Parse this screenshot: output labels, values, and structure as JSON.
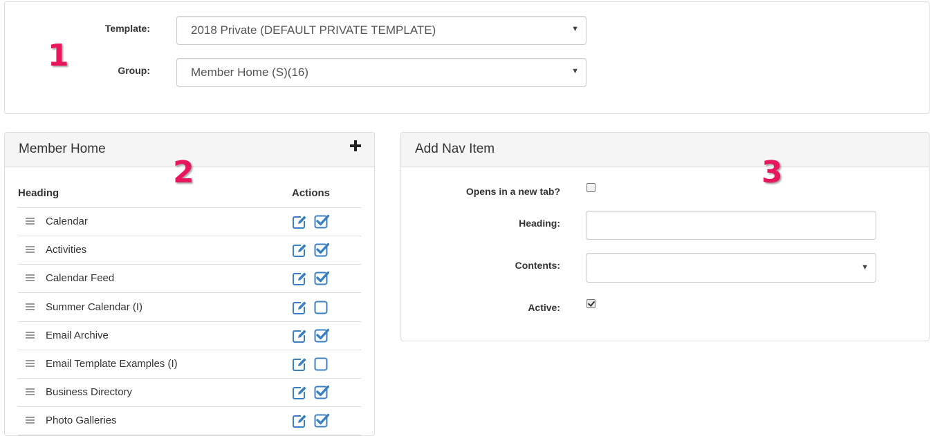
{
  "top_form": {
    "annotation": "1",
    "template_label": "Template:",
    "template_value": "2018 Private (DEFAULT PRIVATE TEMPLATE)",
    "group_label": "Group:",
    "group_value": "Member Home (S)(16)"
  },
  "nav_list": {
    "annotation": "2",
    "title": "Member Home",
    "add_icon": "plus-icon",
    "columns": [
      "Heading",
      "Actions"
    ],
    "items": [
      {
        "label": "Calendar",
        "active": true
      },
      {
        "label": "Activities",
        "active": true
      },
      {
        "label": "Calendar Feed",
        "active": true
      },
      {
        "label": "Summer Calendar (I)",
        "active": false
      },
      {
        "label": "Email Archive",
        "active": true
      },
      {
        "label": "Email Template Examples (I)",
        "active": false
      },
      {
        "label": "Business Directory",
        "active": true
      },
      {
        "label": "Photo Galleries",
        "active": true
      }
    ]
  },
  "add_nav": {
    "annotation": "3",
    "title": "Add Nav Item",
    "new_tab_label": "Opens in a new tab?",
    "new_tab_checked": false,
    "heading_label": "Heading:",
    "heading_value": "",
    "contents_label": "Contents:",
    "contents_value": "",
    "active_label": "Active:",
    "active_checked": true
  },
  "colors": {
    "annotation": "#e8175d",
    "icon_blue": "#3a7fc1",
    "panel_heading_bg": "#f5f5f5",
    "border": "#dddddd"
  }
}
